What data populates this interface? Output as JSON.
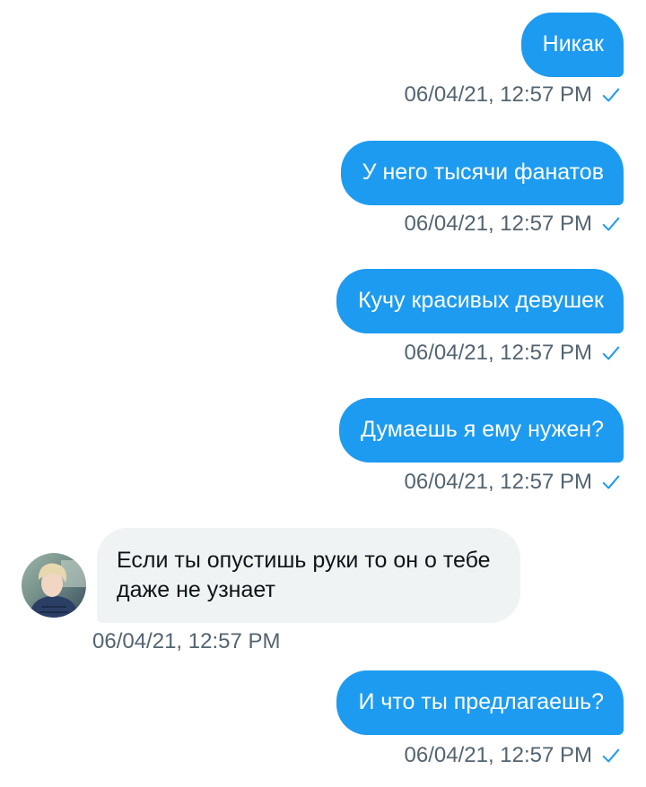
{
  "messages": [
    {
      "direction": "outgoing",
      "text": "Никак",
      "timestamp": "06/04/21, 12:57 PM",
      "status": "sent"
    },
    {
      "direction": "outgoing",
      "text": "У него тысячи фанатов",
      "timestamp": "06/04/21, 12:57 PM",
      "status": "sent"
    },
    {
      "direction": "outgoing",
      "text": "Кучу красивых девушек",
      "timestamp": "06/04/21, 12:57 PM",
      "status": "sent"
    },
    {
      "direction": "outgoing",
      "text": "Думаешь я ему нужен?",
      "timestamp": "06/04/21, 12:57 PM",
      "status": "sent"
    },
    {
      "direction": "incoming",
      "text": "Если ты опустишь руки то он о тебе даже не узнает",
      "timestamp": "06/04/21, 12:57 PM"
    },
    {
      "direction": "outgoing",
      "text": "И что ты предлагаешь?",
      "timestamp": "06/04/21, 12:57 PM",
      "status": "sent"
    }
  ],
  "icons": {
    "sent": "checkmark-icon",
    "sender": "contact-avatar"
  },
  "colors": {
    "outgoing_bubble": "#1d9bf0",
    "outgoing_text": "#ffffff",
    "incoming_bubble": "#eff3f4",
    "incoming_text": "#0f1419",
    "timestamp": "#536471",
    "check": "#1d9bf0"
  }
}
